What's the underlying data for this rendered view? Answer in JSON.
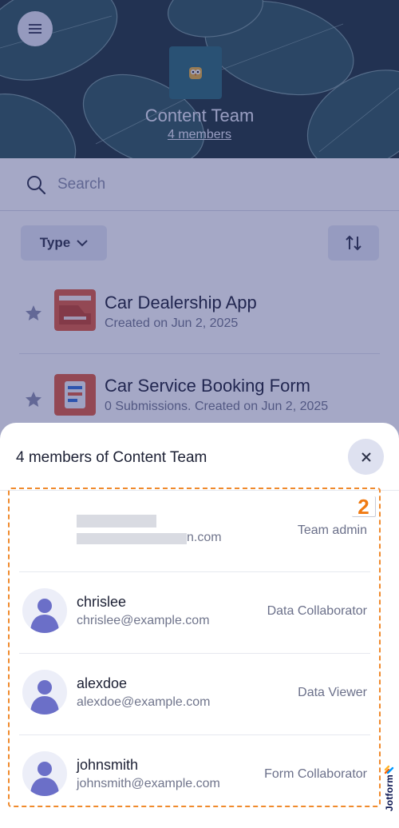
{
  "header": {
    "team_name": "Content Team",
    "members_link": "4 members"
  },
  "search": {
    "placeholder": "Search"
  },
  "toolbar": {
    "type_label": "Type"
  },
  "forms": [
    {
      "title": "Car Dealership App",
      "subtitle": "Created on Jun 2, 2025"
    },
    {
      "title": "Car Service Booking Form",
      "subtitle": "0 Submissions. Created on Jun 2, 2025"
    }
  ],
  "sheet": {
    "title": "4 members of Content Team",
    "members": [
      {
        "name": "",
        "email": "n.com",
        "role": "Team admin"
      },
      {
        "name": "chrislee",
        "email": "chrislee@example.com",
        "role": "Data Collaborator"
      },
      {
        "name": "alexdoe",
        "email": "alexdoe@example.com",
        "role": "Data Viewer"
      },
      {
        "name": "johnsmith",
        "email": "johnsmith@example.com",
        "role": "Form Collaborator"
      }
    ]
  },
  "annotation": {
    "step_number": "2"
  },
  "brand": {
    "name": "Jotform"
  },
  "colors": {
    "accent": "#f08a2c",
    "overlay": "#283078",
    "avatar": "#6b6fc8"
  }
}
